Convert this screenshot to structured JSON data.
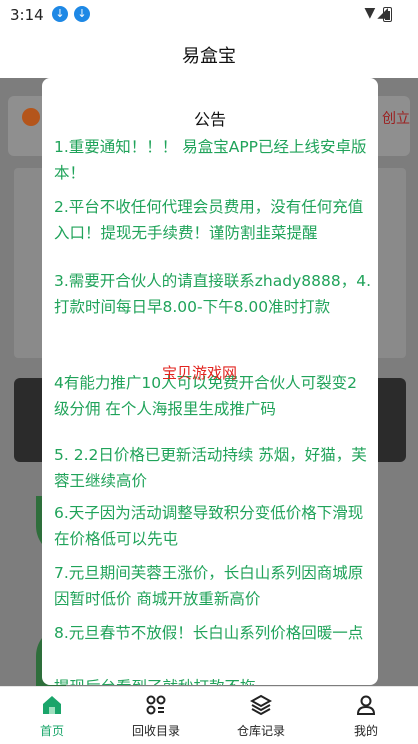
{
  "status_bar": {
    "time": "3:14"
  },
  "app": {
    "title": "易盒宝"
  },
  "background": {
    "right_text": "创立"
  },
  "modal": {
    "title": "公告",
    "items": [
      "1.重要通知！！！ 易盒宝APP已经上线安卓版本！",
      "2.平台不收任何代理会员费用，没有任何充值入口！提现无手续费！谨防割韭菜提醒",
      "3.需要开合伙人的请直接联系zhady8888，4.打款时间每日早8.00-下午8.00准时打款",
      "4有能力推广10人可以免费开合伙人可裂变2级分佣 在个人海报里生成推广码",
      "5. 2.2日价格已更新活动持续 苏烟，好猫，芙蓉王继续高价",
      "6.天子因为活动调整导致积分变低价格下滑现在价格低可以先屯",
      "7.元旦期间芙蓉王涨价，长白山系列因商城原因暂时低价 商城开放重新高价",
      "8.元旦春节不放假！长白山系列价格回暖一点",
      "提现后台看到了就秒打款不拖"
    ],
    "watermark": "宝贝游戏网"
  },
  "tabs": [
    {
      "label": "首页",
      "icon": "home-icon",
      "active": true
    },
    {
      "label": "回收目录",
      "icon": "grid-icon",
      "active": false
    },
    {
      "label": "仓库记录",
      "icon": "layers-icon",
      "active": false
    },
    {
      "label": "我的",
      "icon": "user-icon",
      "active": false
    }
  ],
  "colors": {
    "accent": "#1aa56a",
    "notice_text": "#20a35a",
    "watermark": "#e2241f"
  }
}
